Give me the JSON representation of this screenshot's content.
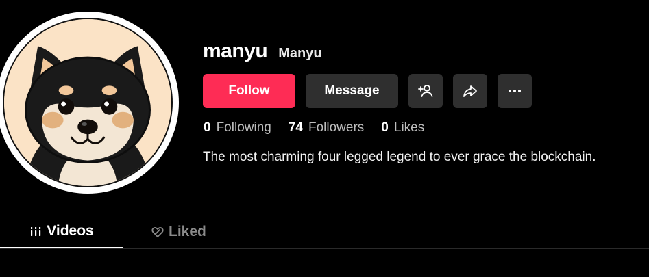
{
  "profile": {
    "username": "manyu",
    "nickname": "Manyu",
    "bio": "The most charming four legged legend to ever grace the blockchain."
  },
  "actions": {
    "follow_label": "Follow",
    "message_label": "Message",
    "icons": [
      "add-friend-icon",
      "share-icon",
      "more-icon"
    ]
  },
  "stats": {
    "following_count": "0",
    "following_label": "Following",
    "followers_count": "74",
    "followers_label": "Followers",
    "likes_count": "0",
    "likes_label": "Likes"
  },
  "tabs": [
    {
      "label": "Videos",
      "icon": "grid-icon",
      "active": true
    },
    {
      "label": "Liked",
      "icon": "liked-heart-icon",
      "active": false
    }
  ],
  "colors": {
    "background": "#000000",
    "follow_button": "#fe2c55",
    "secondary_button": "#2f2f2f"
  }
}
